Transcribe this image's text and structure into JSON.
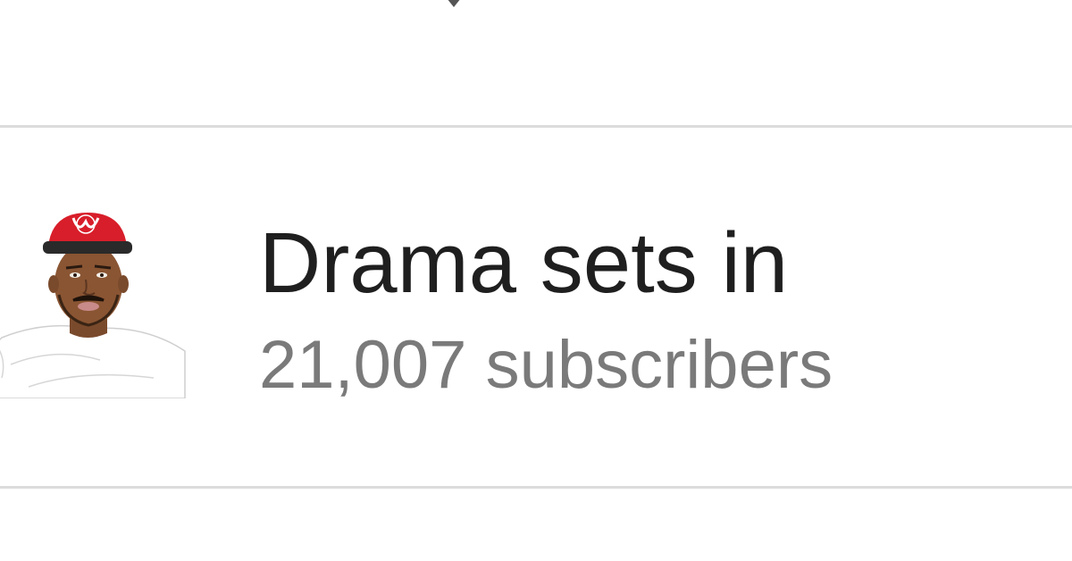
{
  "channel": {
    "name": "Drama sets in",
    "subscribers": "21,007 subscribers",
    "avatar_icon": "cartoon-avatar-red-cap"
  },
  "colors": {
    "name_text": "#1f1f1f",
    "subscriber_text": "#7a7a7a",
    "divider": "#dcdcdc",
    "cap_red": "#d81e2a"
  }
}
